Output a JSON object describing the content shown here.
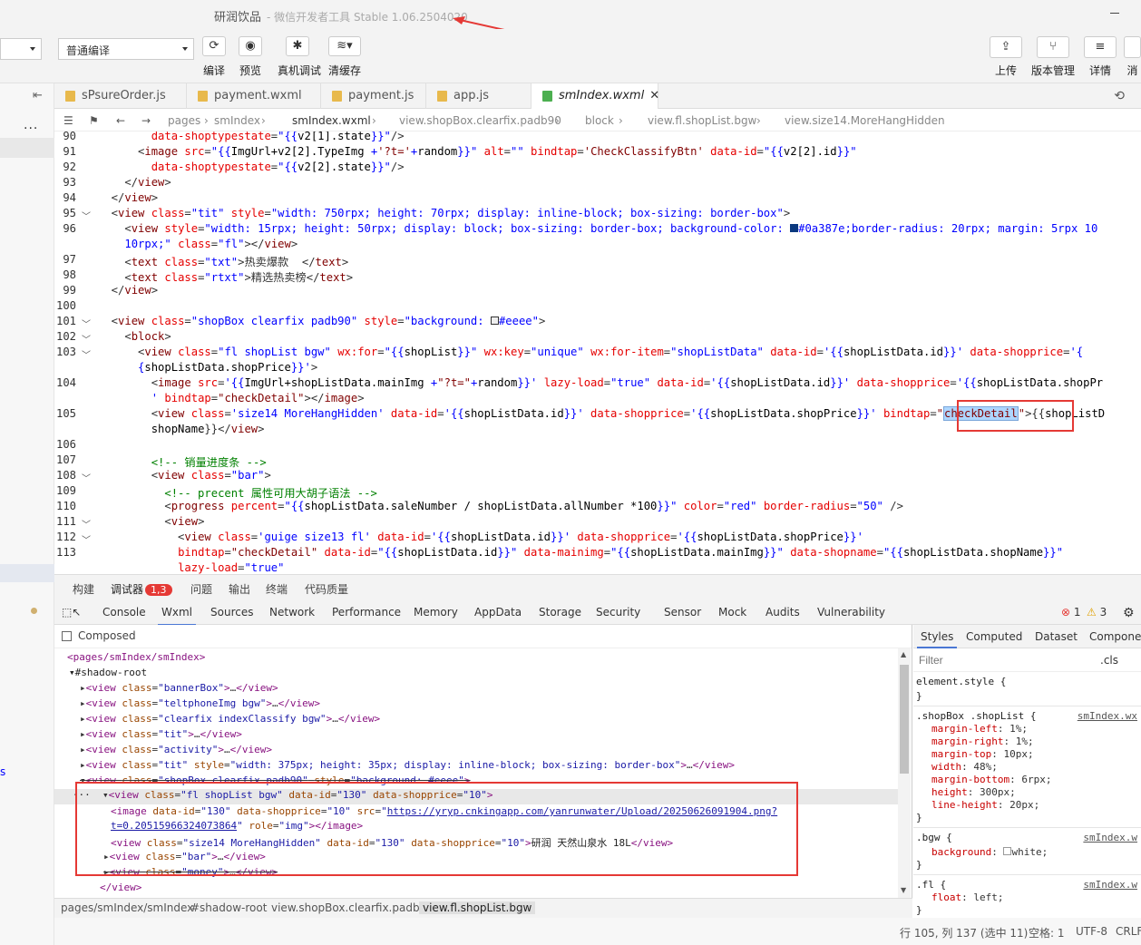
{
  "window": {
    "title": "研润饮品",
    "subtitle": "- 微信开发者工具 Stable 1.06.2504020"
  },
  "toolbar": {
    "mode_select": "",
    "compile_select": "普通编译",
    "buttons": [
      {
        "label": "编译",
        "icon": "refresh-icon"
      },
      {
        "label": "预览",
        "icon": "eye-icon"
      },
      {
        "label": "真机调试",
        "icon": "bug-icon"
      },
      {
        "label": "清缓存",
        "icon": "layers-icon"
      }
    ],
    "right_buttons": [
      {
        "label": "上传",
        "icon": "upload-icon"
      },
      {
        "label": "版本管理",
        "icon": "branch-icon"
      },
      {
        "label": "详情",
        "icon": "menu-icon"
      },
      {
        "label": "消",
        "icon": "message-icon"
      }
    ]
  },
  "file_tabs": [
    {
      "label": "sPsureOrder.js"
    },
    {
      "label": "payment.wxml"
    },
    {
      "label": "payment.js"
    },
    {
      "label": "app.js"
    },
    {
      "label": "smIndex.wxml",
      "active": true
    }
  ],
  "breadcrumb": [
    "pages",
    "smIndex",
    "smIndex.wxml",
    "view.shopBox.clearfix.padb90",
    "block",
    "view.fl.shopList.bgw",
    "view.size14.MoreHangHidden"
  ],
  "editor": {
    "line_numbers": [
      "90",
      "91",
      "92",
      "93",
      "94",
      "95",
      "96",
      "",
      "97",
      "98",
      "99",
      "100",
      "101",
      "102",
      "103",
      "",
      "104",
      "",
      "105",
      "",
      "106",
      "107",
      "108",
      "109",
      "110",
      "111",
      "112",
      "113"
    ]
  },
  "panel_tabs": {
    "items": [
      "构建",
      "调试器",
      "问题",
      "输出",
      "终端",
      "代码质量"
    ],
    "debugger_badge": "1,3"
  },
  "devtools_tabs": [
    "Console",
    "Wxml",
    "Sources",
    "Network",
    "Performance",
    "Memory",
    "AppData",
    "Storage",
    "Security",
    "Sensor",
    "Mock",
    "Audits",
    "Vulnerability"
  ],
  "devtools_counts": {
    "errors": "1",
    "warnings": "3"
  },
  "elements": {
    "composed_label": "Composed",
    "crumbs": [
      "pages/smIndex/smIndex",
      "#shadow-root",
      "view.shopBox.clearfix.padb90",
      "view.fl.shopList.bgw"
    ]
  },
  "styles_panel": {
    "tabs": [
      "Styles",
      "Computed",
      "Dataset",
      "Componen"
    ],
    "filter_placeholder": "Filter",
    "cls_label": ".cls",
    "rules": [
      {
        "selector": "element.style {",
        "props": [],
        "source": ""
      },
      {
        "selector": ".shopBox .shopList {",
        "source": "smIndex.wx",
        "props": [
          [
            "margin-left",
            "1%;"
          ],
          [
            "margin-right",
            "1%;"
          ],
          [
            "margin-top",
            "10px;"
          ],
          [
            "width",
            "48%;"
          ],
          [
            "margin-bottom",
            "6rpx;"
          ],
          [
            "height",
            "300px;"
          ],
          [
            "line-height",
            "20px;"
          ]
        ]
      },
      {
        "selector": ".bgw {",
        "source": "smIndex.w",
        "props": [
          [
            "background",
            "white;"
          ]
        ]
      },
      {
        "selector": ".fl {",
        "source": "smIndex.w",
        "props": [
          [
            "float",
            "left;"
          ]
        ]
      }
    ]
  },
  "status_bar": {
    "position": "行 105, 列 137 (选中 11)",
    "spaces": "空格: 1",
    "encoding": "UTF-8",
    "eol": "CRLF"
  },
  "colors": {
    "accent_red": "#e53935",
    "toolbar_bg": "#f3f3f3",
    "tab_active_blue": "#4a77d4"
  }
}
